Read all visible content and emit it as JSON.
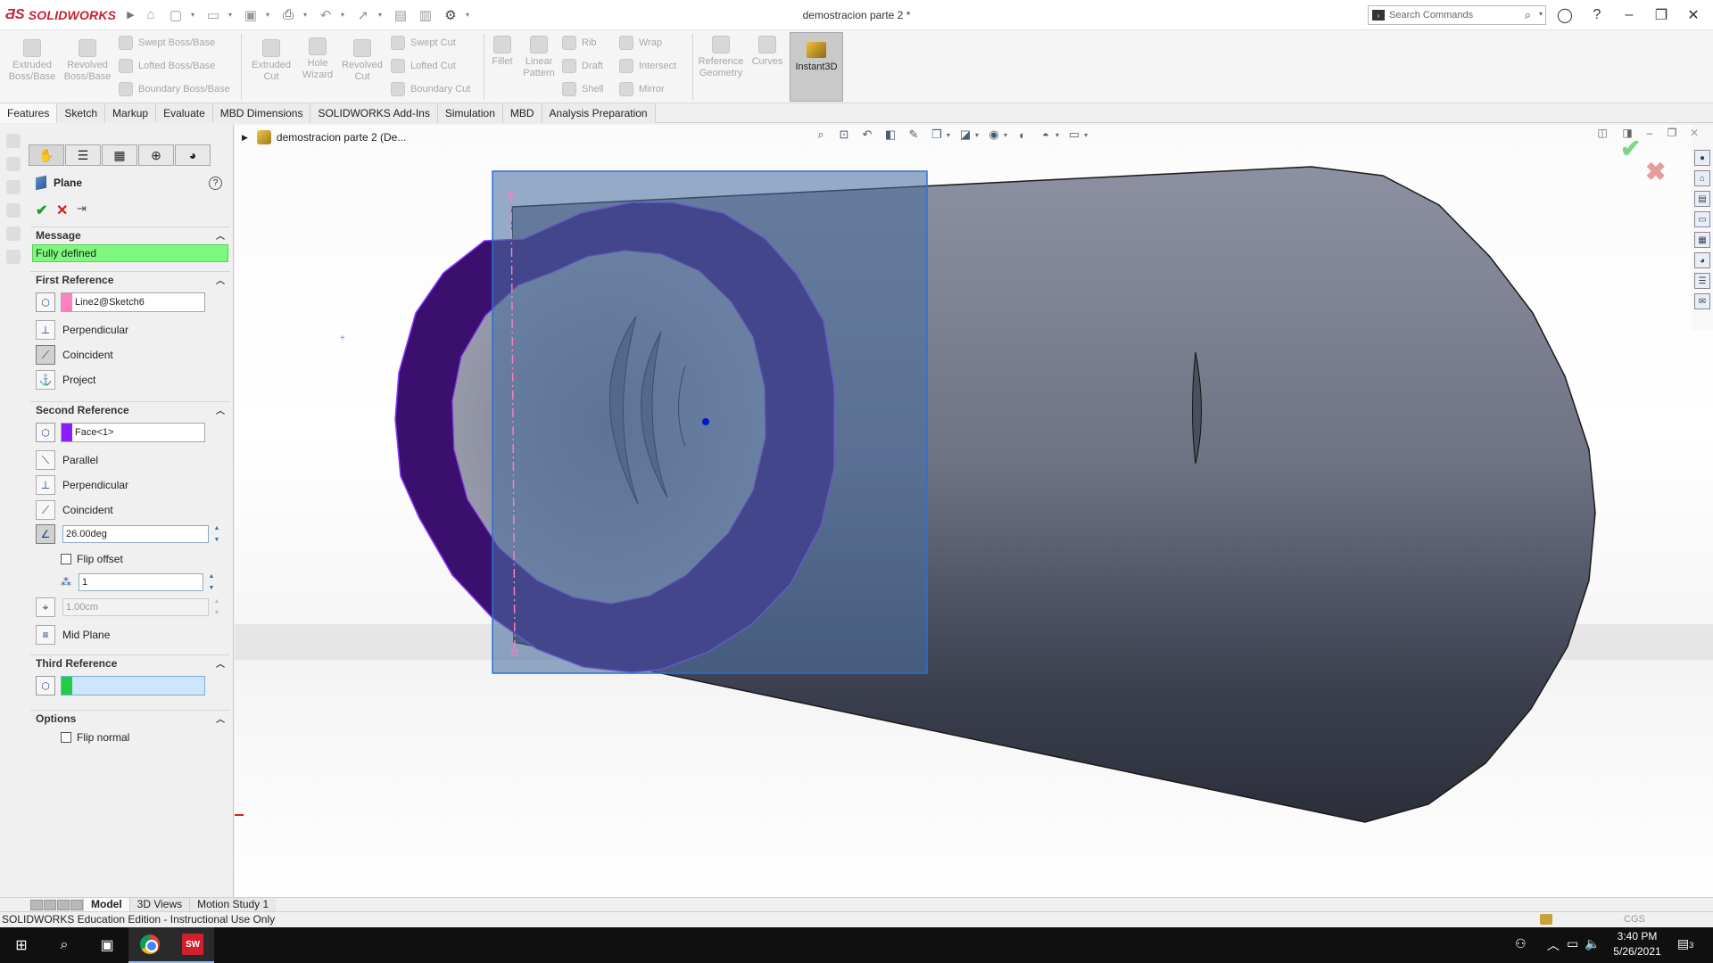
{
  "app": {
    "brand": "SOLIDWORKS",
    "document_title": "demostracion parte 2 *"
  },
  "search": {
    "placeholder": "Search Commands"
  },
  "ribbon": {
    "extruded_boss": "Extruded\nBoss/Base",
    "revolved_boss": "Revolved\nBoss/Base",
    "swept_boss": "Swept Boss/Base",
    "lofted_boss": "Lofted Boss/Base",
    "boundary_boss": "Boundary Boss/Base",
    "extruded_cut": "Extruded\nCut",
    "hole_wizard": "Hole\nWizard",
    "revolved_cut": "Revolved\nCut",
    "swept_cut": "Swept Cut",
    "lofted_cut": "Lofted Cut",
    "boundary_cut": "Boundary Cut",
    "fillet": "Fillet",
    "linear_pattern": "Linear\nPattern",
    "rib": "Rib",
    "draft": "Draft",
    "shell": "Shell",
    "wrap": "Wrap",
    "intersect": "Intersect",
    "mirror": "Mirror",
    "reference_geometry": "Reference\nGeometry",
    "curves": "Curves",
    "instant3d": "Instant3D"
  },
  "tabs": [
    "Features",
    "Sketch",
    "Markup",
    "Evaluate",
    "MBD Dimensions",
    "SOLIDWORKS Add-Ins",
    "Simulation",
    "MBD",
    "Analysis Preparation"
  ],
  "property_manager": {
    "title": "Plane",
    "message_header": "Message",
    "message": "Fully defined",
    "first_reference": {
      "header": "First Reference",
      "selection": "Line2@Sketch6",
      "color": "#ff7fbf",
      "options": [
        "Perpendicular",
        "Coincident",
        "Project"
      ]
    },
    "second_reference": {
      "header": "Second Reference",
      "selection": "Face<1>",
      "color": "#8a1cff",
      "options": [
        "Parallel",
        "Perpendicular",
        "Coincident"
      ],
      "angle": "26.00deg",
      "flip_offset": "Flip offset",
      "instances": "1",
      "distance": "1.00cm",
      "mid_plane": "Mid Plane"
    },
    "third_reference": {
      "header": "Third Reference",
      "selection": "",
      "color": "#22cc44"
    },
    "options": {
      "header": "Options",
      "flip_normal": "Flip normal"
    }
  },
  "graphics": {
    "tree_flyout": "demostracion parte 2  (De...",
    "ring_color": "#3a0f6e",
    "plane_color": "#4a6f9f",
    "body_color": "#6e7384"
  },
  "bottom_tabs": [
    "Model",
    "3D Views",
    "Motion Study 1"
  ],
  "status": {
    "text": "SOLIDWORKS Education Edition - Instructional Use Only",
    "units": "CGS"
  },
  "taskbar": {
    "time": "3:40 PM",
    "date": "5/26/2021",
    "notifications": "3"
  }
}
